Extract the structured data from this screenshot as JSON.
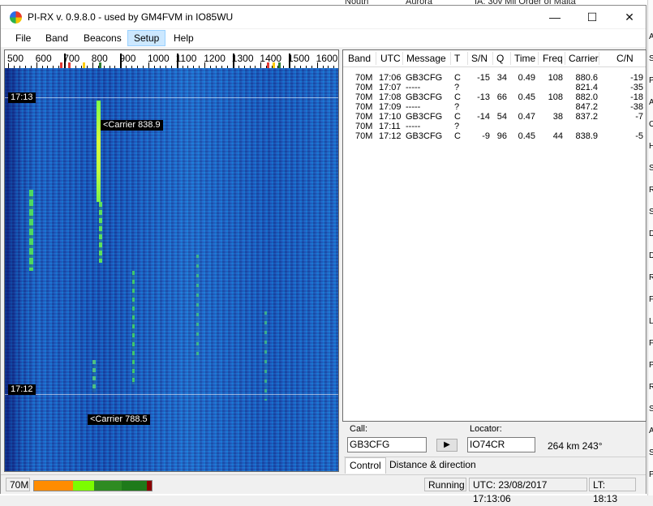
{
  "backdrop": {
    "top_texts": [
      "Nouth",
      "Aurora",
      "IA: 30v Mil Order of Malta"
    ],
    "right_letters": [
      "A",
      "S",
      "P",
      "A",
      "O",
      "H",
      "S",
      "R",
      "S",
      "D",
      "D",
      "R",
      "F",
      "L",
      "F",
      "P",
      "R",
      "S",
      "A",
      "S",
      "P"
    ]
  },
  "window": {
    "title": "PI-RX v. 0.9.8.0 - used by GM4FVM in IO85WU",
    "minimize_glyph": "—",
    "maximize_glyph": "☐",
    "close_glyph": "✕"
  },
  "menu": {
    "items": [
      "File",
      "Band",
      "Beacons",
      "Setup",
      "Help"
    ],
    "active": "Setup"
  },
  "waterfall": {
    "freq_labels": [
      "500",
      "600",
      "700",
      "800",
      "900",
      "1000",
      "1100",
      "1200",
      "1300",
      "1400",
      "1500",
      "1600"
    ],
    "time_labels": [
      "17:13",
      "17:12"
    ],
    "carrier_labels": [
      "<Carrier 838.9",
      "<Carrier 788.5"
    ],
    "marker_colors": [
      "#e53935",
      "#ffcc00",
      "#2e7d32"
    ]
  },
  "decode_table": {
    "headers": [
      "Band",
      "UTC",
      "Message",
      "T",
      "S/N",
      "Q",
      "Time",
      "Freq",
      "Carrier",
      "C/N"
    ],
    "rows": [
      [
        "70M",
        "17:06",
        "GB3CFG",
        "C",
        "-15",
        "34",
        "0.49",
        "108",
        "880.6",
        "-19"
      ],
      [
        "70M",
        "17:07",
        "-----",
        "?",
        "",
        "",
        "",
        "",
        "821.4",
        "-35"
      ],
      [
        "70M",
        "17:08",
        "GB3CFG",
        "C",
        "-13",
        "66",
        "0.45",
        "108",
        "882.0",
        "-18"
      ],
      [
        "70M",
        "17:09",
        "-----",
        "?",
        "",
        "",
        "",
        "",
        "847.2",
        "-38"
      ],
      [
        "70M",
        "17:10",
        "GB3CFG",
        "C",
        "-14",
        "54",
        "0.47",
        "38",
        "837.2",
        "-7"
      ],
      [
        "70M",
        "17:11",
        "-----",
        "?",
        "",
        "",
        "",
        "",
        "",
        ""
      ],
      [
        "70M",
        "17:12",
        "GB3CFG",
        "C",
        "-9",
        "96",
        "0.45",
        "44",
        "838.9",
        "-5"
      ]
    ]
  },
  "controls": {
    "call_label": "Call:",
    "call_value": "GB3CFG",
    "play_glyph": "▶",
    "locator_label": "Locator:",
    "locator_value": "IO74CR",
    "distance": "264 km 243°",
    "tabs": [
      "Control",
      "Distance & direction"
    ],
    "selected_tab": "Control"
  },
  "status": {
    "band": "70M",
    "level_colors": [
      "#ff8c00",
      "#7cfc00",
      "#2e8b22",
      "#1e7a1a",
      "#8b0000"
    ],
    "state": "Running",
    "utc": "UTC:  23/08/2017   17:13:06",
    "lt": "LT:  18:13"
  }
}
